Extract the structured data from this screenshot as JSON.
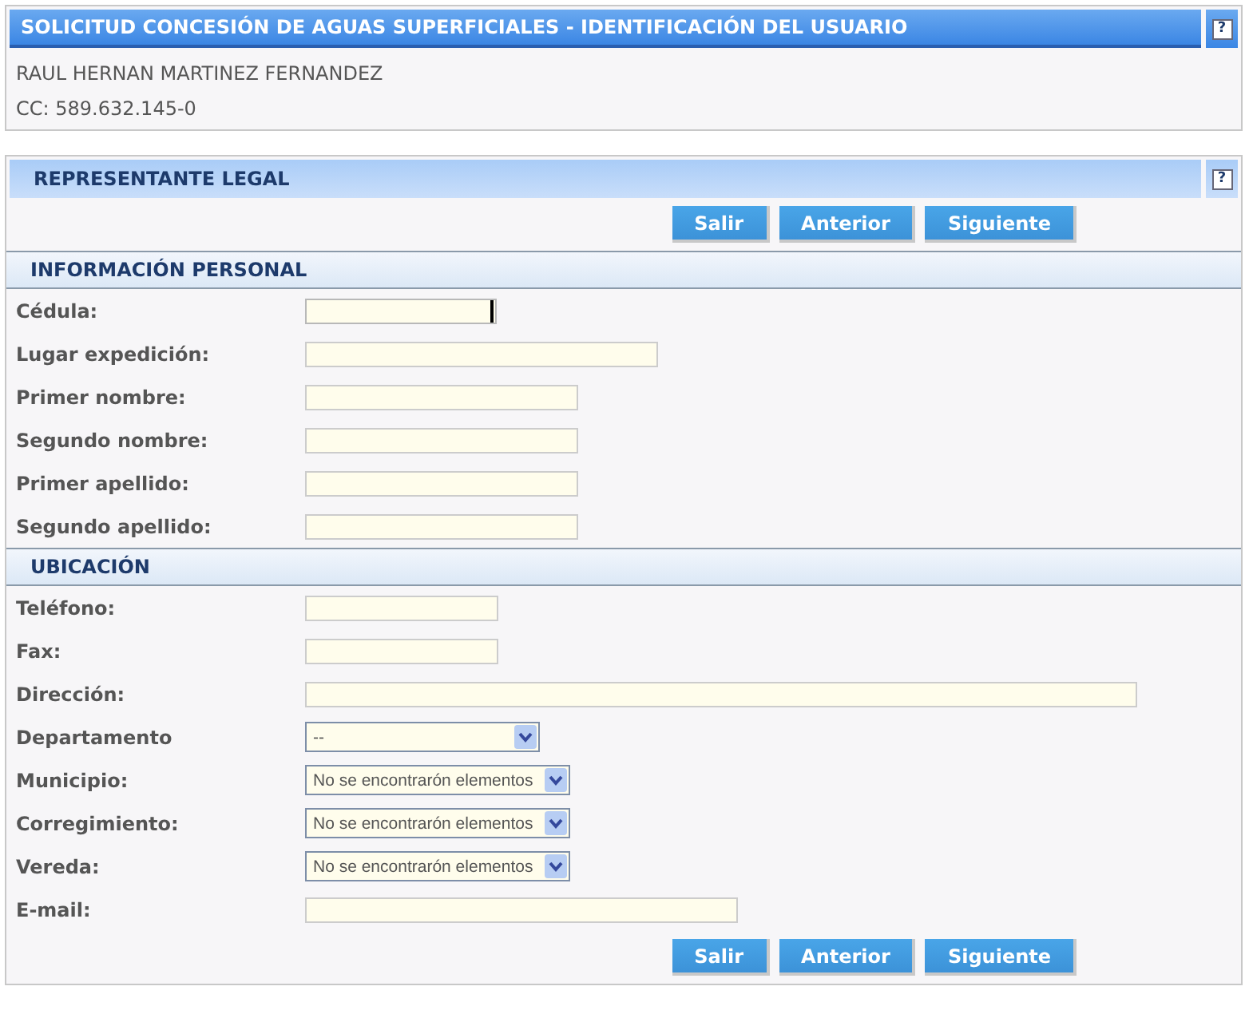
{
  "user_panel": {
    "title": "SOLICITUD CONCESIÓN DE AGUAS SUPERFICIALES - IDENTIFICACIÓN DEL USUARIO",
    "help": "?",
    "name": "RAUL HERNAN MARTINEZ FERNANDEZ",
    "id_line": "CC: 589.632.145-0"
  },
  "form_panel": {
    "title": "REPRESENTANTE LEGAL",
    "help": "?",
    "top_buttons": [
      "Salir",
      "Anterior",
      "Siguiente"
    ],
    "sections": [
      {
        "title": "INFORMACIÓN PERSONAL",
        "fields": [
          {
            "label": "Cédula:",
            "kind": "text",
            "focused": true
          },
          {
            "label": "Lugar expedición:",
            "kind": "text",
            "focused": false
          },
          {
            "label": "Primer nombre:",
            "kind": "text",
            "focused": false
          },
          {
            "label": "Segundo nombre:",
            "kind": "text",
            "focused": false
          },
          {
            "label": "Primer apellido:",
            "kind": "text",
            "focused": false
          },
          {
            "label": "Segundo apellido:",
            "kind": "text",
            "focused": false
          }
        ]
      },
      {
        "title": "UBICACIÓN",
        "fields": [
          {
            "label": "Teléfono:",
            "kind": "text",
            "focused": false
          },
          {
            "label": "Fax:",
            "kind": "text",
            "focused": false
          },
          {
            "label": "Dirección:",
            "kind": "text",
            "focused": false
          },
          {
            "label": "Departamento",
            "kind": "select",
            "value": "--"
          },
          {
            "label": "Municipio:",
            "kind": "select",
            "value": "No se encontrarón elementos"
          },
          {
            "label": "Corregimiento:",
            "kind": "select",
            "value": "No se encontrarón elementos"
          },
          {
            "label": "Vereda:",
            "kind": "select",
            "value": "No se encontrarón elementos"
          },
          {
            "label": "E-mail:",
            "kind": "text",
            "focused": false
          }
        ]
      }
    ],
    "bottom_buttons": [
      "Salir",
      "Anterior",
      "Siguiente"
    ]
  }
}
